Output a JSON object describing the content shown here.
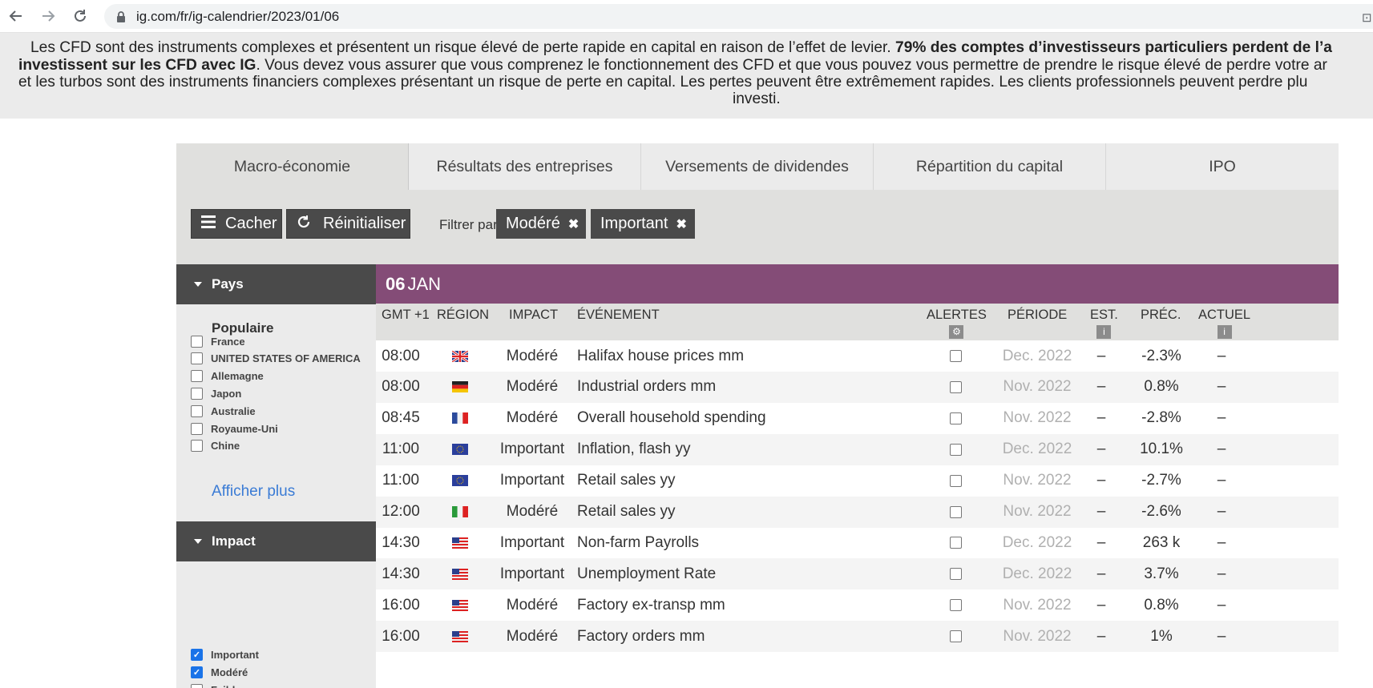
{
  "browser": {
    "url": "ig.com/fr/ig-calendrier/2023/01/06"
  },
  "risk_banner": {
    "line1_normal": "Les CFD sont des instruments complexes et présentent un risque élevé de perte rapide en capital en raison de l’effet de levier. ",
    "line1_bold": "79% des comptes d’investisseurs particuliers perdent de l’a",
    "line2_bold": "investissent sur les CFD avec IG",
    "line2_normal": ". Vous devez vous assurer que vous comprenez le fonctionnement des CFD et que vous pouvez vous permettre de prendre le risque élevé de perdre votre ar",
    "line3": "et les turbos sont des instruments financiers complexes présentant un risque de perte en capital. Les pertes peuvent être extrêmement rapides. Les clients professionnels peuvent perdre plu",
    "line4": "investi."
  },
  "tabs": [
    {
      "label": "Macro-économie",
      "active": true
    },
    {
      "label": "Résultats des entreprises",
      "active": false
    },
    {
      "label": "Versements de dividendes",
      "active": false
    },
    {
      "label": "Répartition du capital",
      "active": false
    },
    {
      "label": "IPO",
      "active": false
    }
  ],
  "filterbar": {
    "hide_label": "Cacher",
    "reset_label": "Réinitialiser",
    "filter_by_label": "Filtrer par :",
    "chips": [
      "Modéré",
      "Important"
    ]
  },
  "sidebar": {
    "country_header": "Pays",
    "popular_label": "Populaire",
    "countries": [
      {
        "label": "France",
        "checked": false
      },
      {
        "label": "UNITED STATES OF AMERICA",
        "checked": false
      },
      {
        "label": "Allemagne",
        "checked": false
      },
      {
        "label": "Japon",
        "checked": false
      },
      {
        "label": "Australie",
        "checked": false
      },
      {
        "label": "Royaume-Uni",
        "checked": false
      },
      {
        "label": "Chine",
        "checked": false
      }
    ],
    "show_more": "Afficher plus",
    "impact_header": "Impact",
    "impacts": [
      {
        "label": "Important",
        "checked": true
      },
      {
        "label": "Modéré",
        "checked": true
      },
      {
        "label": "Faible",
        "checked": false
      }
    ]
  },
  "date": {
    "day": "06",
    "month": "JAN"
  },
  "columns": {
    "time": "GMT +1",
    "region": "RÉGION",
    "impact": "IMPACT",
    "event": "ÉVÉNEMENT",
    "alerts": "ALERTES",
    "period": "PÉRIODE",
    "est": "EST.",
    "prev": "PRÉC.",
    "actual": "ACTUEL"
  },
  "events": [
    {
      "time": "08:00",
      "flag": "uk-flag-icon",
      "impact": "Modéré",
      "event": "Halifax house prices mm",
      "period": "Dec. 2022",
      "est": "–",
      "prev": "-2.3%",
      "actual": "–"
    },
    {
      "time": "08:00",
      "flag": "germany-flag-icon",
      "impact": "Modéré",
      "event": "Industrial orders mm",
      "period": "Nov. 2022",
      "est": "–",
      "prev": "0.8%",
      "actual": "–"
    },
    {
      "time": "08:45",
      "flag": "france-flag-icon",
      "impact": "Modéré",
      "event": "Overall household spending",
      "period": "Nov. 2022",
      "est": "–",
      "prev": "-2.8%",
      "actual": "–"
    },
    {
      "time": "11:00",
      "flag": "eu-flag-icon",
      "impact": "Important",
      "event": "Inflation, flash yy",
      "period": "Dec. 2022",
      "est": "–",
      "prev": "10.1%",
      "actual": "–"
    },
    {
      "time": "11:00",
      "flag": "eu-flag-icon",
      "impact": "Important",
      "event": "Retail sales yy",
      "period": "Nov. 2022",
      "est": "–",
      "prev": "-2.7%",
      "actual": "–"
    },
    {
      "time": "12:00",
      "flag": "italy-flag-icon",
      "impact": "Modéré",
      "event": "Retail sales yy",
      "period": "Nov. 2022",
      "est": "–",
      "prev": "-2.6%",
      "actual": "–"
    },
    {
      "time": "14:30",
      "flag": "us-flag-icon",
      "impact": "Important",
      "event": "Non-farm Payrolls",
      "period": "Dec. 2022",
      "est": "–",
      "prev": "263 k",
      "actual": "–"
    },
    {
      "time": "14:30",
      "flag": "us-flag-icon",
      "impact": "Important",
      "event": "Unemployment Rate",
      "period": "Dec. 2022",
      "est": "–",
      "prev": "3.7%",
      "actual": "–"
    },
    {
      "time": "16:00",
      "flag": "us-flag-icon",
      "impact": "Modéré",
      "event": "Factory ex-transp mm",
      "period": "Nov. 2022",
      "est": "–",
      "prev": "0.8%",
      "actual": "–"
    },
    {
      "time": "16:00",
      "flag": "us-flag-icon",
      "impact": "Modéré",
      "event": "Factory orders mm",
      "period": "Nov. 2022",
      "est": "–",
      "prev": "1%",
      "actual": "–"
    }
  ],
  "colors": {
    "date_bar": "#844c77",
    "dark_button": "#4a4a4a",
    "link": "#3a7bd5"
  }
}
